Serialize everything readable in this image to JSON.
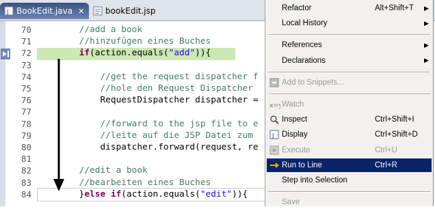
{
  "tabs": [
    {
      "label": "BookEdit.java",
      "active": true,
      "icon": "java-file-icon"
    },
    {
      "label": "bookEdit.jsp",
      "active": false,
      "icon": "jsp-file-icon"
    }
  ],
  "editor": {
    "lines": [
      {
        "num": "70",
        "indent": "        ",
        "parts": [
          {
            "t": "cm",
            "s": "//add a book"
          }
        ]
      },
      {
        "num": "71",
        "indent": "        ",
        "parts": [
          {
            "t": "cm",
            "s": "//hinzufügen eines Buches"
          }
        ]
      },
      {
        "num": "72",
        "indent": "        ",
        "parts": [
          {
            "t": "kw",
            "s": "if"
          },
          {
            "t": "tx",
            "s": "(action.equals("
          },
          {
            "t": "st",
            "s": "\"add\""
          },
          {
            "t": "tx",
            "s": ")){"
          }
        ]
      },
      {
        "num": "73",
        "indent": "",
        "parts": []
      },
      {
        "num": "74",
        "indent": "            ",
        "parts": [
          {
            "t": "cm",
            "s": "//get the request dispatcher f"
          }
        ]
      },
      {
        "num": "75",
        "indent": "            ",
        "parts": [
          {
            "t": "cm",
            "s": "//hole den Request Dispatcher"
          }
        ]
      },
      {
        "num": "76",
        "indent": "            ",
        "parts": [
          {
            "t": "tx",
            "s": "RequestDispatcher dispatcher ="
          }
        ]
      },
      {
        "num": "77",
        "indent": "",
        "parts": []
      },
      {
        "num": "78",
        "indent": "            ",
        "parts": [
          {
            "t": "cm",
            "s": "//forward to the jsp file to e"
          }
        ]
      },
      {
        "num": "79",
        "indent": "            ",
        "parts": [
          {
            "t": "cm",
            "s": "//leite auf die JSP Datei zum"
          }
        ]
      },
      {
        "num": "80",
        "indent": "            ",
        "parts": [
          {
            "t": "tx",
            "s": "dispatcher.forward(request, re"
          }
        ]
      },
      {
        "num": "81",
        "indent": "",
        "parts": []
      },
      {
        "num": "82",
        "indent": "        ",
        "parts": [
          {
            "t": "cm",
            "s": "//edit a book"
          }
        ]
      },
      {
        "num": "83",
        "indent": "        ",
        "parts": [
          {
            "t": "cm",
            "s": "//bearbeiten eines Buches"
          }
        ]
      },
      {
        "num": "84",
        "indent": "        ",
        "parts": [
          {
            "t": "tx",
            "s": "}"
          },
          {
            "t": "kw",
            "s": "else if"
          },
          {
            "t": "tx",
            "s": "(action.equals("
          },
          {
            "t": "st",
            "s": "\"edit\""
          },
          {
            "t": "tx",
            "s": ")){"
          }
        ]
      }
    ]
  },
  "context_menu": {
    "items": [
      {
        "type": "item",
        "label": "Refactor",
        "accel": "Alt+Shift+T",
        "submenu": true,
        "enabled": true,
        "icon": ""
      },
      {
        "type": "item",
        "label": "Local History",
        "accel": "",
        "submenu": true,
        "enabled": true,
        "icon": ""
      },
      {
        "type": "sep"
      },
      {
        "type": "item",
        "label": "References",
        "accel": "",
        "submenu": true,
        "enabled": true,
        "icon": ""
      },
      {
        "type": "item",
        "label": "Declarations",
        "accel": "",
        "submenu": true,
        "enabled": true,
        "icon": ""
      },
      {
        "type": "sep"
      },
      {
        "type": "item",
        "label": "Add to Snippets...",
        "accel": "",
        "submenu": false,
        "enabled": false,
        "icon": "snippet-icon"
      },
      {
        "type": "sep"
      },
      {
        "type": "item",
        "label": "Watch",
        "accel": "",
        "submenu": false,
        "enabled": false,
        "icon": "watch-icon"
      },
      {
        "type": "item",
        "label": "Inspect",
        "accel": "Ctrl+Shift+I",
        "submenu": false,
        "enabled": true,
        "icon": "inspect-icon"
      },
      {
        "type": "item",
        "label": "Display",
        "accel": "Ctrl+Shift+D",
        "submenu": false,
        "enabled": true,
        "icon": "display-icon"
      },
      {
        "type": "item",
        "label": "Execute",
        "accel": "Ctrl+U",
        "submenu": false,
        "enabled": false,
        "icon": "execute-icon"
      },
      {
        "type": "item",
        "label": "Run to Line",
        "accel": "Ctrl+R",
        "submenu": false,
        "enabled": true,
        "selected": true,
        "icon": "run-to-line-icon"
      },
      {
        "type": "item",
        "label": "Step into Selection",
        "accel": "",
        "submenu": false,
        "enabled": true,
        "icon": ""
      },
      {
        "type": "sep"
      },
      {
        "type": "item",
        "label": "Save",
        "accel": "",
        "submenu": false,
        "enabled": false,
        "icon": ""
      }
    ]
  },
  "colors": {
    "comment": "#3f7f5f",
    "keyword": "#7f0055",
    "string": "#2a00ff",
    "current_line_highlight": "#cde8b3",
    "menu_selection": "#0a246a"
  }
}
